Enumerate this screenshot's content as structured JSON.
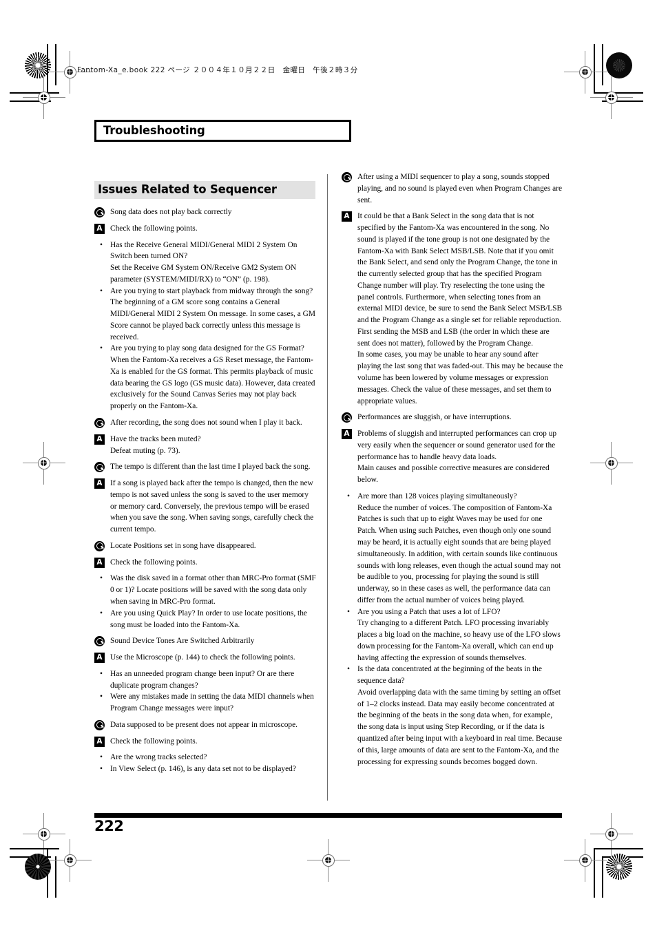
{
  "running_head": "Fantom-Xa_e.book  222 ページ  ２００４年１０月２２日　金曜日　午後２時３分",
  "chapter_title": "Troubleshooting",
  "section_title": "Issues Related to Sequencer",
  "page_number": "222",
  "badges": {
    "question": "Q",
    "answer": "A"
  },
  "bullet_glyph": "•",
  "colors": {
    "section_band": "#e2e2e2",
    "rule": "#000000",
    "text": "#000000",
    "column_rule": "#6b6b6b"
  },
  "left_column": [
    {
      "kind": "question",
      "text": "Song data does not play back correctly"
    },
    {
      "kind": "answer",
      "text": "Check the following points.",
      "bullets": [
        [
          "Has the Receive General MIDI/General MIDI 2 System On Switch been turned ON?",
          "Set the Receive GM System ON/Receive GM2 System ON parameter (SYSTEM/MIDI/RX) to “ON” (p. 198)."
        ],
        [
          "Are you trying to start playback from midway through the song?",
          "The beginning of a GM score song contains a General MIDI/General MIDI 2 System On message. In some cases, a GM Score cannot be played back correctly unless this message is received."
        ],
        [
          "Are you trying to play song data designed for the GS Format?",
          "When the Fantom-Xa receives a GS Reset message, the Fantom-Xa is enabled for the GS format. This permits playback of music data bearing the GS logo (GS music data). However, data created exclusively for the Sound Canvas Series may not play back properly on the Fantom-Xa."
        ]
      ]
    },
    {
      "kind": "question",
      "text": "After recording, the song does not sound when I play it back."
    },
    {
      "kind": "answer",
      "text": "Have the tracks been muted?",
      "paragraphs": [
        "Defeat muting (p. 73)."
      ]
    },
    {
      "kind": "question",
      "text": "The tempo is different than the last time I played back the song."
    },
    {
      "kind": "answer",
      "text": "If a song is played back after the tempo is changed, then the new tempo is not saved unless the song is saved to the user memory or memory card. Conversely, the previous tempo will be erased when you save the song. When saving songs, carefully check the current tempo."
    },
    {
      "kind": "question",
      "text": "Locate Positions set in song have disappeared."
    },
    {
      "kind": "answer",
      "text": "Check the following points.",
      "bullets": [
        [
          "Was the disk saved in a format other than MRC-Pro format (SMF 0 or 1)? Locate positions will be saved with the song data only when saving in MRC-Pro format."
        ],
        [
          "Are you using Quick Play? In order to use locate positions, the song must be loaded into the Fantom-Xa."
        ]
      ]
    },
    {
      "kind": "question",
      "text": "Sound Device Tones Are Switched Arbitrarily"
    },
    {
      "kind": "answer",
      "text": "Use the Microscope (p. 144) to check the following points.",
      "bullets": [
        [
          "Has an unneeded program change been input? Or are there duplicate program changes?"
        ],
        [
          "Were any mistakes made in setting the data MIDI channels when Program Change messages were input?"
        ]
      ]
    },
    {
      "kind": "question",
      "text": "Data supposed to be present does not appear in microscope."
    },
    {
      "kind": "answer",
      "text": "Check the following points.",
      "bullets": [
        [
          "Are the wrong tracks selected?"
        ],
        [
          "In View Select (p. 146), is any data set not to be displayed?"
        ]
      ]
    }
  ],
  "right_column": [
    {
      "kind": "question",
      "text": "After using a MIDI sequencer to play a song, sounds stopped playing, and no sound is played even when Program Changes are sent."
    },
    {
      "kind": "answer",
      "text": "It could be that a Bank Select in the song data that is not specified by the Fantom-Xa was encountered in the song. No sound is played if the tone group is not one designated by the Fantom-Xa with Bank Select MSB/LSB. Note that if you omit the Bank Select, and send only the Program Change, the tone in the currently selected group that has the specified Program Change number will play. Try reselecting the tone using the panel controls. Furthermore, when selecting tones from an external MIDI device, be sure to send the Bank Select MSB/LSB and the Program Change as a single set for reliable reproduction. First sending the MSB and LSB (the order in which these are sent does not matter), followed by the Program Change.",
      "paragraphs": [
        "In some cases, you may be unable to hear any sound after playing the last song that was faded-out. This may be because the volume has been lowered by volume messages or expression messages. Check the value of these messages, and set them to appropriate values."
      ]
    },
    {
      "kind": "question",
      "text": "Performances are sluggish, or have interruptions."
    },
    {
      "kind": "answer",
      "text": "Problems of sluggish and interrupted performances can crop up very easily when the sequencer or sound generator used for the performance has to handle heavy data loads.",
      "paragraphs": [
        "Main causes and possible corrective measures are considered below."
      ],
      "bullets": [
        [
          "Are more than 128 voices playing simultaneously?",
          "Reduce the number of voices. The composition of Fantom-Xa Patches is such that up to eight Waves may be used for one Patch. When using such Patches, even though only one sound may be heard, it is actually eight sounds that are being played simultaneously. In addition, with certain sounds like continuous sounds with long releases, even though the actual sound may not be audible to you, processing for playing the sound is still underway, so in these cases as well, the performance data can differ from the actual number of voices being played."
        ],
        [
          "Are you using a Patch that uses a lot of LFO?",
          "Try changing to a different Patch. LFO processing invariably places a big load on the machine, so heavy use of the LFO slows down processing for the Fantom-Xa overall, which can end up having affecting the expression of sounds themselves."
        ],
        [
          "Is the data concentrated at the beginning of the beats in the sequence data?",
          "Avoid overlapping data with the same timing by setting an offset of 1–2 clocks instead. Data may easily become concentrated at the beginning of the beats in the song data when, for example, the song data is input using Step Recording, or if the data is quantized after being input with a keyboard in real time. Because of this, large amounts of data are sent to the Fantom-Xa, and the processing for expressing sounds becomes bogged down."
        ]
      ]
    }
  ]
}
